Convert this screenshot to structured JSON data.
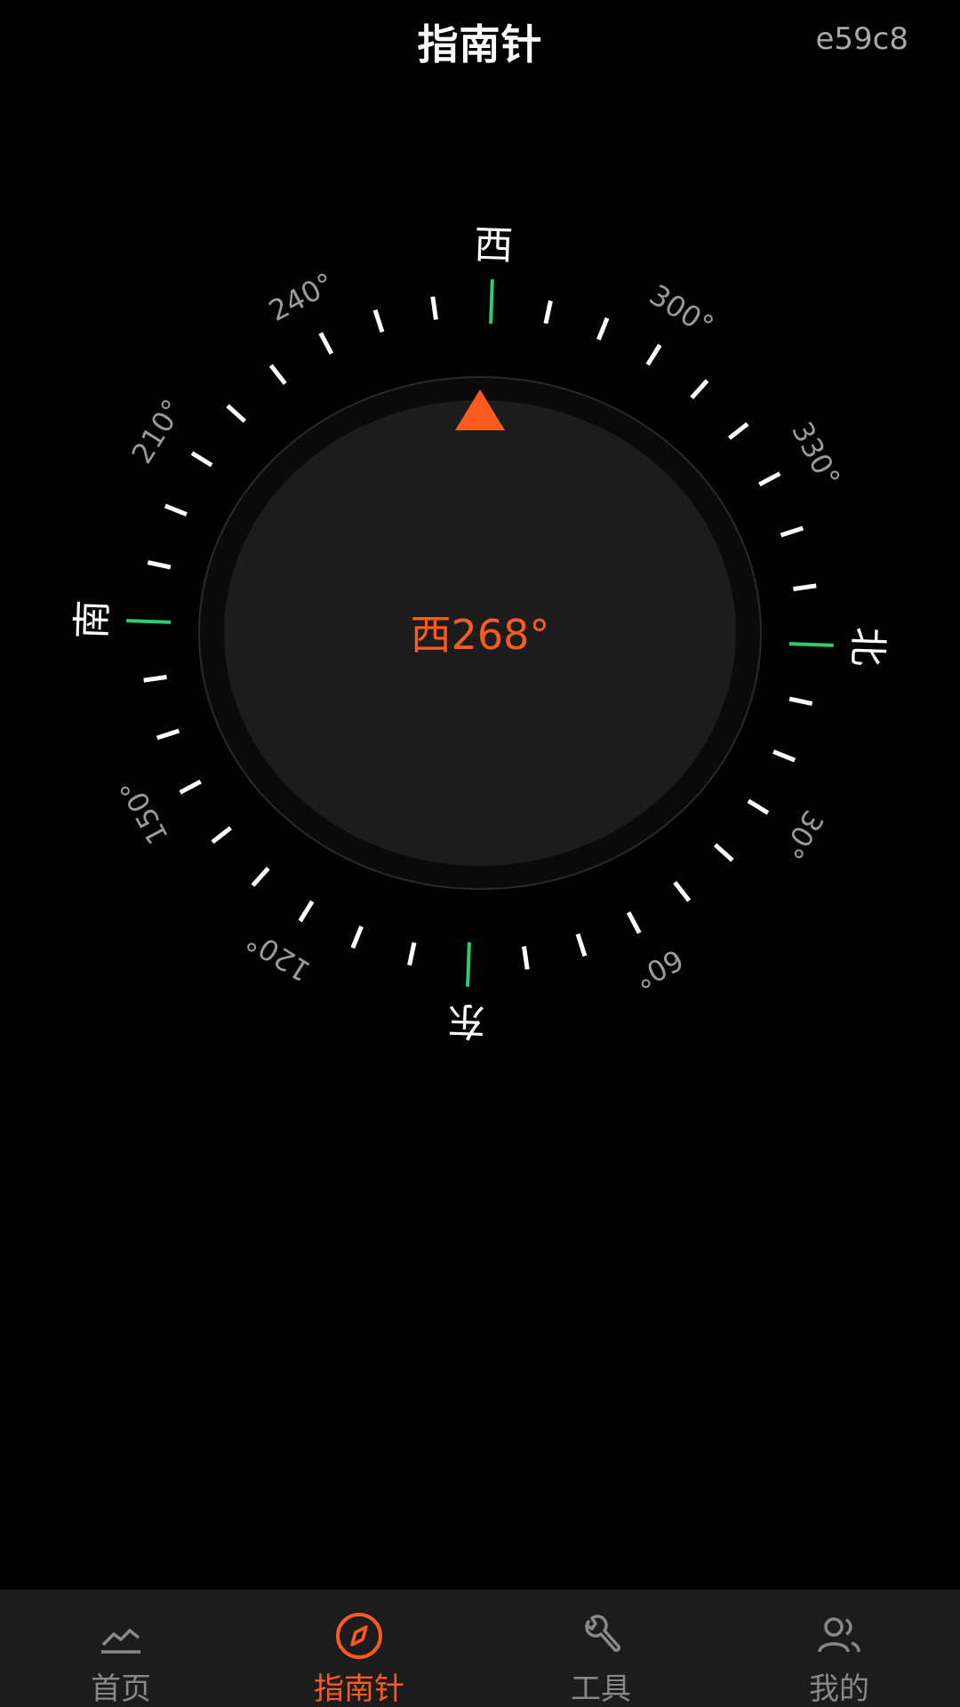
{
  "header": {
    "title": "指南针",
    "corner_code": "e59c8"
  },
  "compass": {
    "heading_text": "西268°",
    "heading_degrees": 268,
    "accent_color": "#ff5a1f",
    "cardinal_color": "#2ecc71",
    "cardinals": [
      {
        "label": "北",
        "bearing": 0
      },
      {
        "label": "东",
        "bearing": 90
      },
      {
        "label": "南",
        "bearing": 180
      },
      {
        "label": "西",
        "bearing": 270
      }
    ],
    "degree_labels": [
      {
        "label": "30°",
        "bearing": 30
      },
      {
        "label": "60°",
        "bearing": 60
      },
      {
        "label": "120°",
        "bearing": 120
      },
      {
        "label": "150°",
        "bearing": 150
      },
      {
        "label": "210°",
        "bearing": 210
      },
      {
        "label": "240°",
        "bearing": 240
      },
      {
        "label": "300°",
        "bearing": 300
      },
      {
        "label": "330°",
        "bearing": 330
      }
    ]
  },
  "pager": {
    "count": 4,
    "active_index": 1
  },
  "tabbar": {
    "tabs": [
      {
        "label": "首页",
        "icon": "home-chart-icon",
        "active": false
      },
      {
        "label": "指南针",
        "icon": "compass-icon",
        "active": true
      },
      {
        "label": "工具",
        "icon": "wrench-icon",
        "active": false
      },
      {
        "label": "我的",
        "icon": "users-icon",
        "active": false
      }
    ]
  }
}
